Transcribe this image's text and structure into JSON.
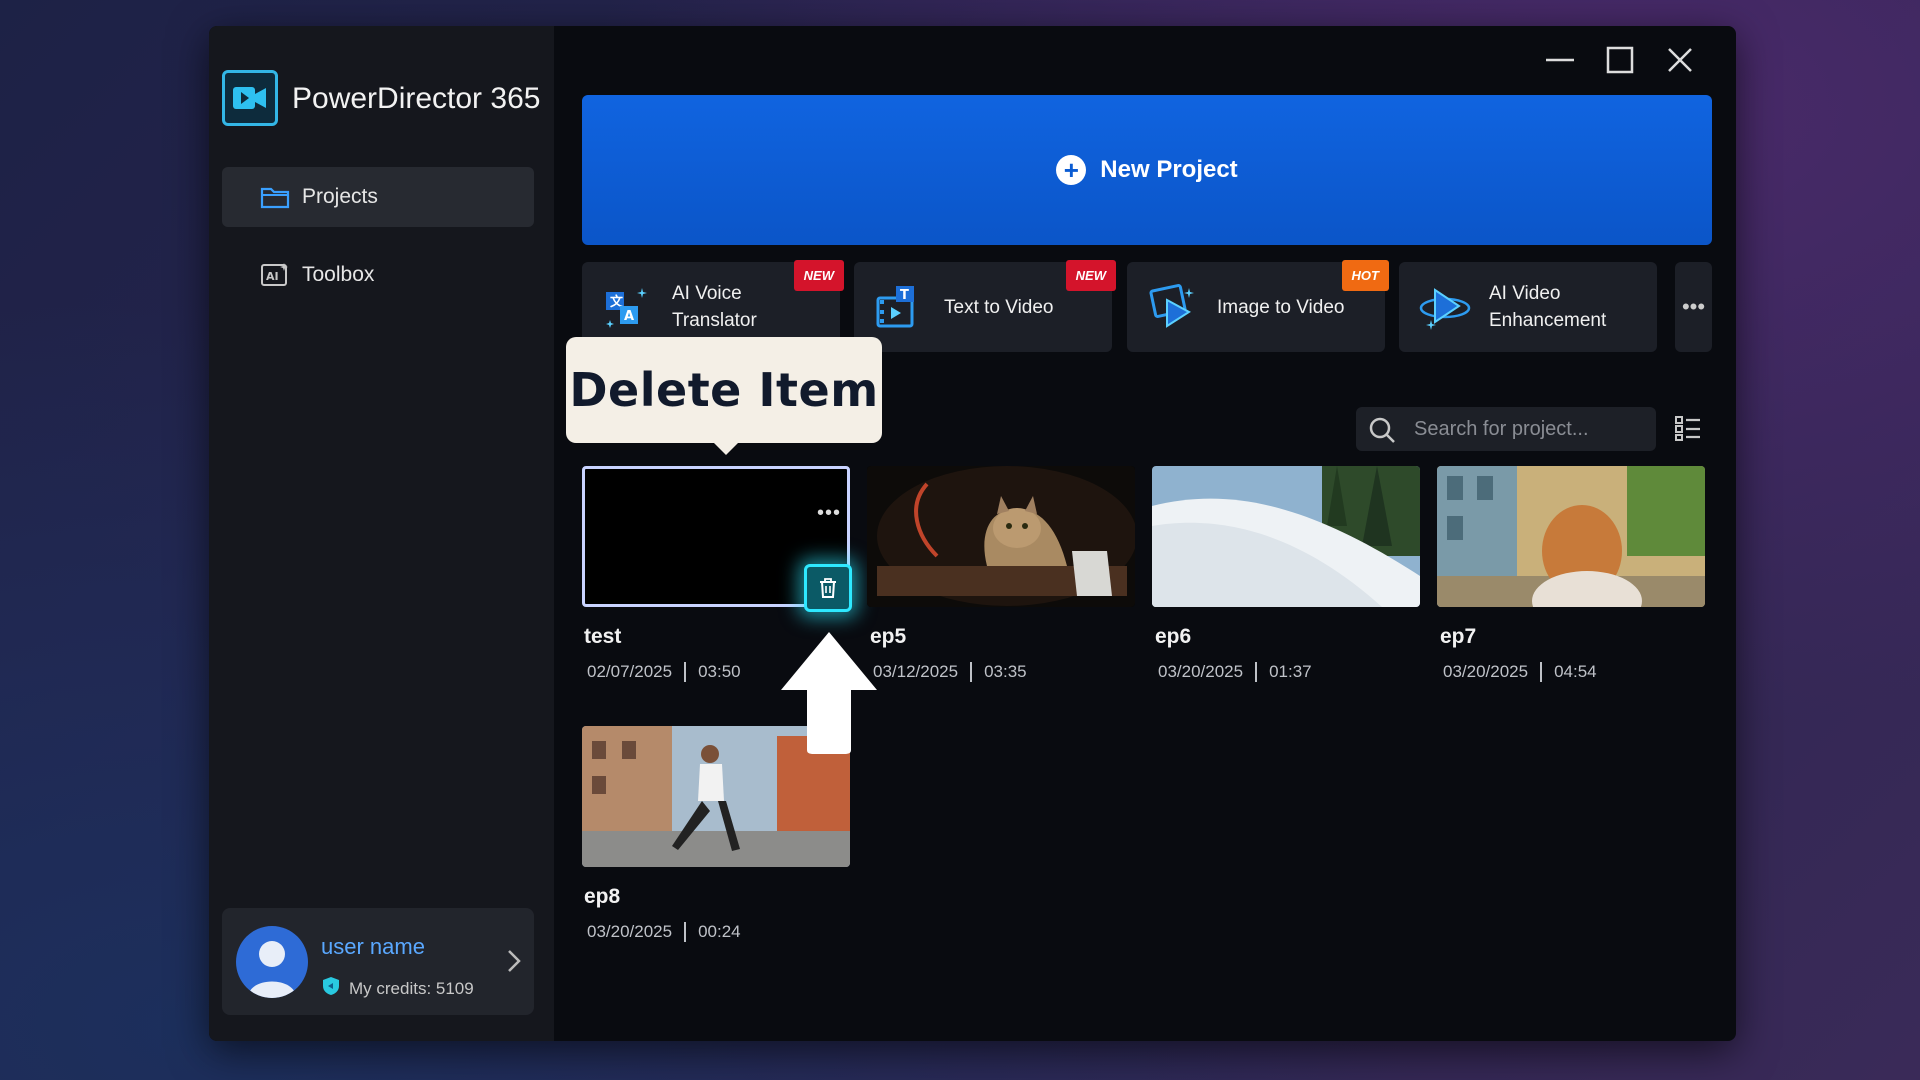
{
  "app": {
    "title": "PowerDirector 365"
  },
  "sidebar": {
    "items": [
      {
        "label": "Projects",
        "icon": "folder-icon",
        "active": true
      },
      {
        "label": "Toolbox",
        "icon": "ai-toolbox-icon",
        "active": false
      }
    ]
  },
  "user": {
    "name": "user name",
    "credits_label": "My credits: 5109"
  },
  "header": {
    "new_project_label": "New Project"
  },
  "tools": [
    {
      "label_line1": "AI Voice",
      "label_line2": "Translator",
      "badge": "NEW",
      "icon": "ai-voice-translator-icon"
    },
    {
      "label_line1": "Text to Video",
      "label_line2": "",
      "badge": "NEW",
      "icon": "text-to-video-icon"
    },
    {
      "label_line1": "Image to Video",
      "label_line2": "",
      "badge": "HOT",
      "icon": "image-to-video-icon"
    },
    {
      "label_line1": "AI Video",
      "label_line2": "Enhancement",
      "badge": "",
      "icon": "ai-video-enhancement-icon"
    }
  ],
  "more_label": "•••",
  "search": {
    "placeholder": "Search for project..."
  },
  "tooltip": {
    "text": "Delete Item"
  },
  "projects": [
    {
      "name": "test",
      "date": "02/07/2025",
      "duration": "03:50"
    },
    {
      "name": "ep5",
      "date": "03/12/2025",
      "duration": "03:35"
    },
    {
      "name": "ep6",
      "date": "03/20/2025",
      "duration": "01:37"
    },
    {
      "name": "ep7",
      "date": "03/20/2025",
      "duration": "04:54"
    },
    {
      "name": "ep8",
      "date": "03/20/2025",
      "duration": "00:24"
    }
  ],
  "thumb_menu_label": "•••",
  "colors": {
    "accent": "#1064e0",
    "badge_new": "#d4142b",
    "badge_hot": "#f06a12",
    "highlight": "#2ee8ff"
  }
}
